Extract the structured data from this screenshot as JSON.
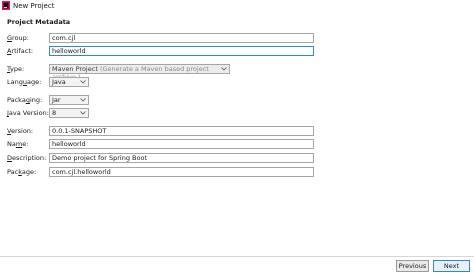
{
  "window": {
    "title": "New Project"
  },
  "section": {
    "title": "Project Metadata"
  },
  "form": {
    "group": {
      "label_key": "G",
      "label_rest": "roup:",
      "value": "com.cjl"
    },
    "artifact": {
      "label_key": "A",
      "label_rest": "rtifact:",
      "value": "helloworld"
    },
    "type": {
      "label_key": "T",
      "label_rest": "ype:",
      "value": "Maven Project",
      "hint": "(Generate a Maven based project archive.)"
    },
    "language": {
      "label_pre": "Lang",
      "label_key": "u",
      "label_rest": "age:",
      "value": "Java"
    },
    "packaging": {
      "label_pre": "Packa",
      "label_key": "g",
      "label_rest": "ing:",
      "value": "Jar"
    },
    "java_version": {
      "label_key": "J",
      "label_rest": "ava Version:",
      "value": "8"
    },
    "version": {
      "label_key": "V",
      "label_rest": "ersion:",
      "value": "0.0.1-SNAPSHOT"
    },
    "name": {
      "label_pre": "Na",
      "label_key": "m",
      "label_rest": "e:",
      "value": "helloworld"
    },
    "description": {
      "label_key": "D",
      "label_rest": "escription:",
      "value": "Demo project for Spring Boot"
    },
    "package": {
      "label_pre": "Pac",
      "label_key": "k",
      "label_rest": "age:",
      "value": "com.cjl.helloworld"
    }
  },
  "buttons": {
    "previous": "Previous",
    "next": "Next"
  },
  "icons": {
    "app": "intellij-app-icon",
    "dropdown": "chevron-down-icon"
  },
  "colors": {
    "focus_border": "#2f86d6",
    "field_border": "#a6a6a6"
  }
}
